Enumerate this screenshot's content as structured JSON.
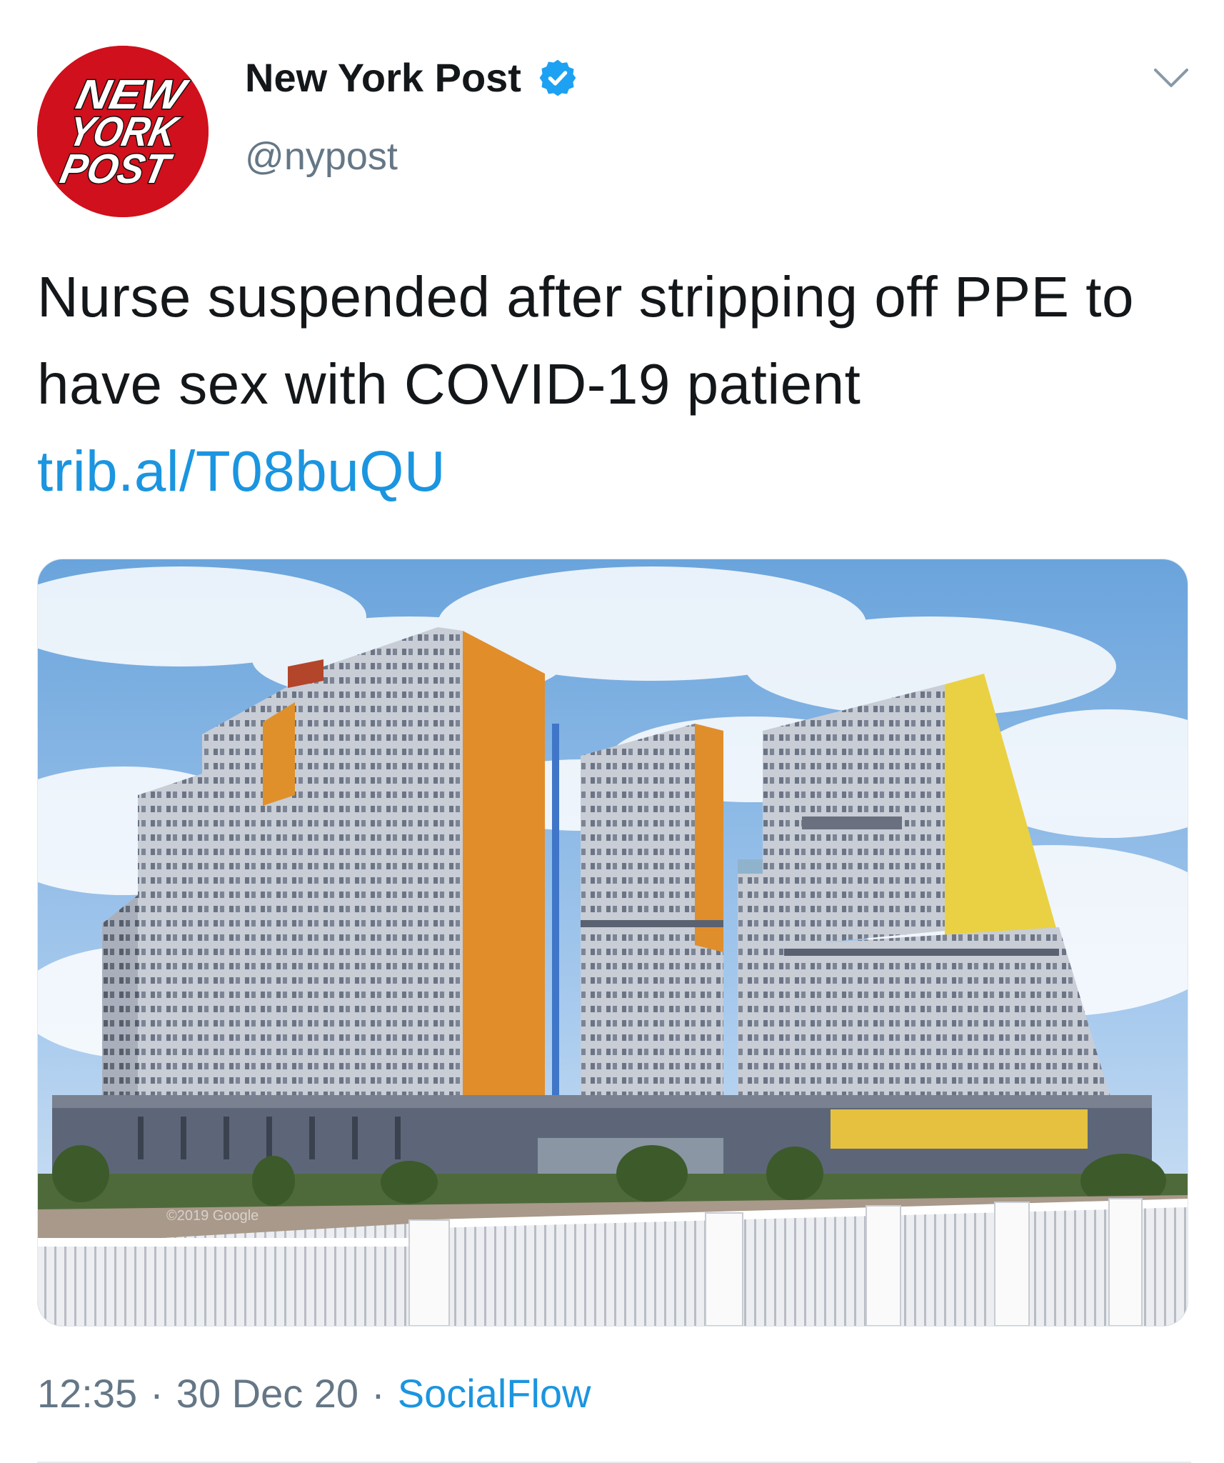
{
  "account": {
    "display_name": "New York Post",
    "handle": "@nypost",
    "verified": true,
    "avatar_logo_lines": [
      "NEW",
      "YORK",
      "POST"
    ],
    "avatar_color": "#d0101c"
  },
  "tweet": {
    "text": "Nurse suspended after stripping off PPE to have sex with COVID-19 patient",
    "link_text": "trib.al/T08buQU"
  },
  "media": {
    "watermark": "©2019 Google"
  },
  "meta": {
    "time": "12:35",
    "date": "30 Dec 20",
    "separator": "·",
    "source": "SocialFlow"
  },
  "colors": {
    "link": "#1b95e0",
    "secondary_text": "#657786",
    "verified_badge": "#1da1f2"
  },
  "icons": {
    "verified": "verified-badge-icon",
    "menu": "chevron-down-icon"
  }
}
